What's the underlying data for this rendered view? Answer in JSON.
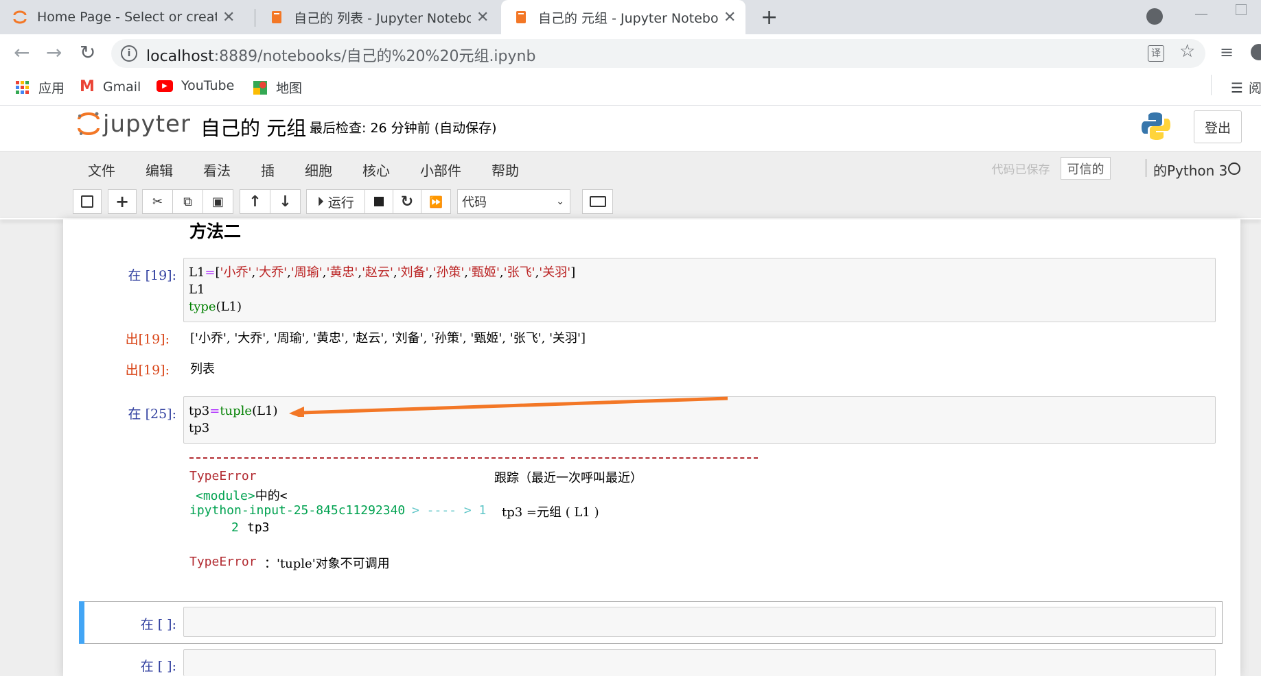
{
  "browser": {
    "tabs": [
      {
        "title": "Home Page - Select or create a notebook",
        "active": false
      },
      {
        "title": "自己的 列表 - Jupyter Notebook",
        "active": false
      },
      {
        "title": "自己的 元组 - Jupyter Notebook",
        "active": true
      }
    ],
    "url_host": "localhost",
    "url_path": ":8889/notebooks/自己的%20%20元组.ipynb",
    "bookmarks": [
      {
        "label": "应用",
        "icon": "apps-grid-icon"
      },
      {
        "label": "Gmail",
        "icon": "gmail-icon"
      },
      {
        "label": "YouTube",
        "icon": "youtube-icon"
      },
      {
        "label": "地图",
        "icon": "maps-icon"
      }
    ],
    "reading_label": "阅"
  },
  "jupyter": {
    "logo_text": "jupyter",
    "notebook_name": "自己的 元组",
    "checkpoint": "最后检查: 26 分钟前  (自动保存)",
    "logout": "登出",
    "menu": [
      "文件",
      "编辑",
      "看法",
      "插",
      "细胞",
      "核心",
      "小部件",
      "帮助"
    ],
    "saved_indicator": "代码已保存",
    "trusted": "可信的",
    "kernel": "的Python 3",
    "run_label": "运行",
    "cell_type": "代码"
  },
  "cells": {
    "heading": "方法二",
    "c1_prompt": "在  [19]:",
    "c1_line2": "L1",
    "c1_line3_kw": "type",
    "c1_line3_rest": "(L1)",
    "o1_prompt": "出[19]:",
    "o1_text": "['小乔', '大乔', '周瑜', '黄忠', '赵云', '刘备', '孙策', '甄姬', '张飞', '关羽']",
    "o2_prompt": "出[19]:",
    "o2_text": "列表",
    "c2_prompt": "在  [25]:",
    "c2_line1_a": "tp3",
    "c2_line1_b": "tuple",
    "c2_line1_c": "(L1)",
    "c2_line2": "tp3",
    "err_type": "TypeError",
    "err_trace_label": "跟踪（最近一次呼叫最近）",
    "err_module": "<module>",
    "err_module_suffix": "中的<",
    "err_input": "ipython-input-25-845c11292340",
    "err_arrow": "> ---- > 1",
    "err_src1": "tp3 =元组 ( L1 )",
    "err_line2_no": "2",
    "err_line2": "tp3",
    "err_final_type": "TypeError",
    "err_final_msg": "：'tuple'对象不可调用",
    "c3_prompt": "在  [  ]:",
    "c4_prompt": "在  [  ]:"
  },
  "colors": {
    "accent_orange": "#f37726",
    "prompt_in": "#303f9f",
    "prompt_out": "#d84315",
    "selected_cell": "#42a5f5"
  }
}
